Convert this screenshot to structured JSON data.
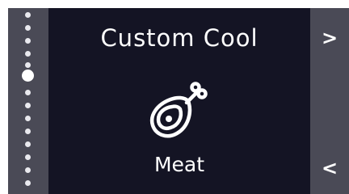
{
  "screen": {
    "title": "Custom Cool",
    "mode_label": "Meat",
    "mode_icon": "meat-drumstick-icon"
  },
  "pager": {
    "total": 14,
    "active_index": 5
  },
  "nav": {
    "next_glyph": ">",
    "prev_glyph": "<"
  },
  "colors": {
    "panel_bg": "#141424",
    "side_bg": "#4a4a56",
    "text": "#ffffff"
  }
}
